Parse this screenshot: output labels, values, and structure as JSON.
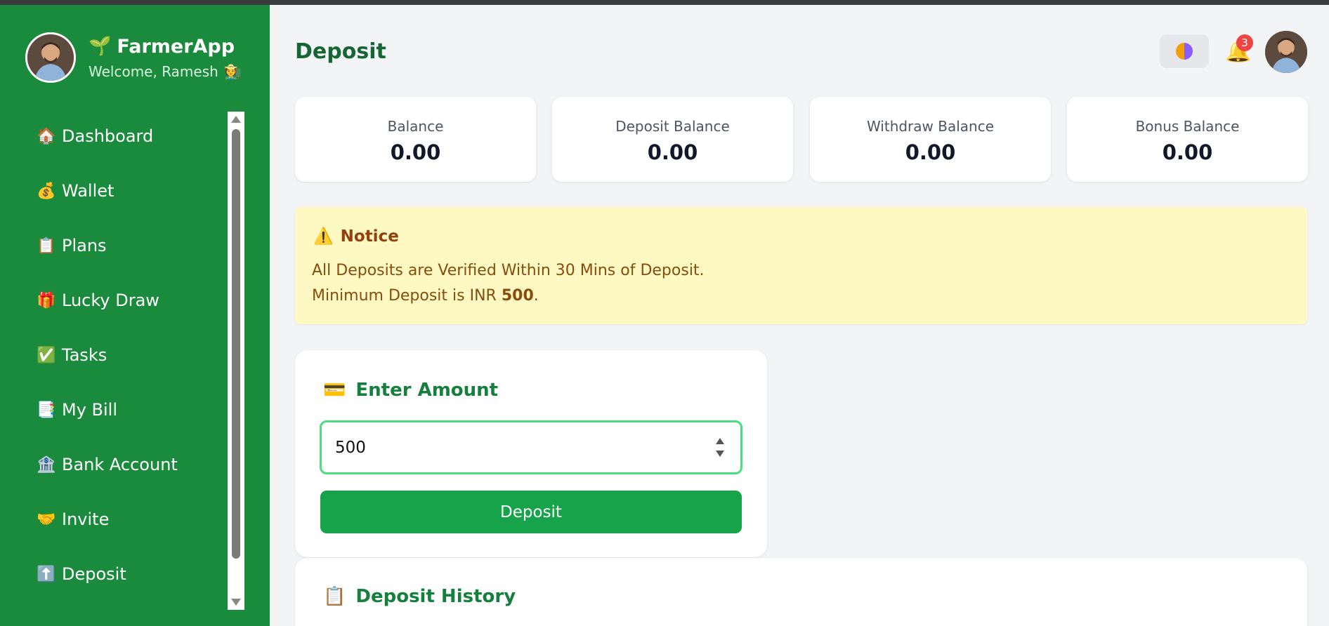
{
  "sidebar": {
    "app_name": "FarmerApp",
    "welcome": "Welcome, Ramesh",
    "items": [
      {
        "label": "Dashboard",
        "icon": "🏠"
      },
      {
        "label": "Wallet",
        "icon": "💰"
      },
      {
        "label": "Plans",
        "icon": "📋"
      },
      {
        "label": "Lucky Draw",
        "icon": "🎁"
      },
      {
        "label": "Tasks",
        "icon": "✅"
      },
      {
        "label": "My Bill",
        "icon": "📑"
      },
      {
        "label": "Bank Account",
        "icon": "🏦"
      },
      {
        "label": "Invite",
        "icon": "🤝"
      },
      {
        "label": "Deposit",
        "icon": "⬆️"
      }
    ]
  },
  "header": {
    "title": "Deposit",
    "notification_count": "3"
  },
  "balances": [
    {
      "label": "Balance",
      "value": "0.00"
    },
    {
      "label": "Deposit Balance",
      "value": "0.00"
    },
    {
      "label": "Withdraw Balance",
      "value": "0.00"
    },
    {
      "label": "Bonus Balance",
      "value": "0.00"
    }
  ],
  "notice": {
    "title": "Notice",
    "line1": "All Deposits are Verified Within 30 Mins of Deposit.",
    "line2_prefix": "Minimum Deposit is INR ",
    "line2_amount": "500",
    "line2_suffix": "."
  },
  "deposit_form": {
    "heading": "Enter Amount",
    "amount_value": "500",
    "button_label": "Deposit"
  },
  "history": {
    "heading": "Deposit History"
  },
  "colors": {
    "sidebar_bg": "#1a8a3c",
    "accent": "#16a34a",
    "notice_bg": "#fef9c3"
  }
}
